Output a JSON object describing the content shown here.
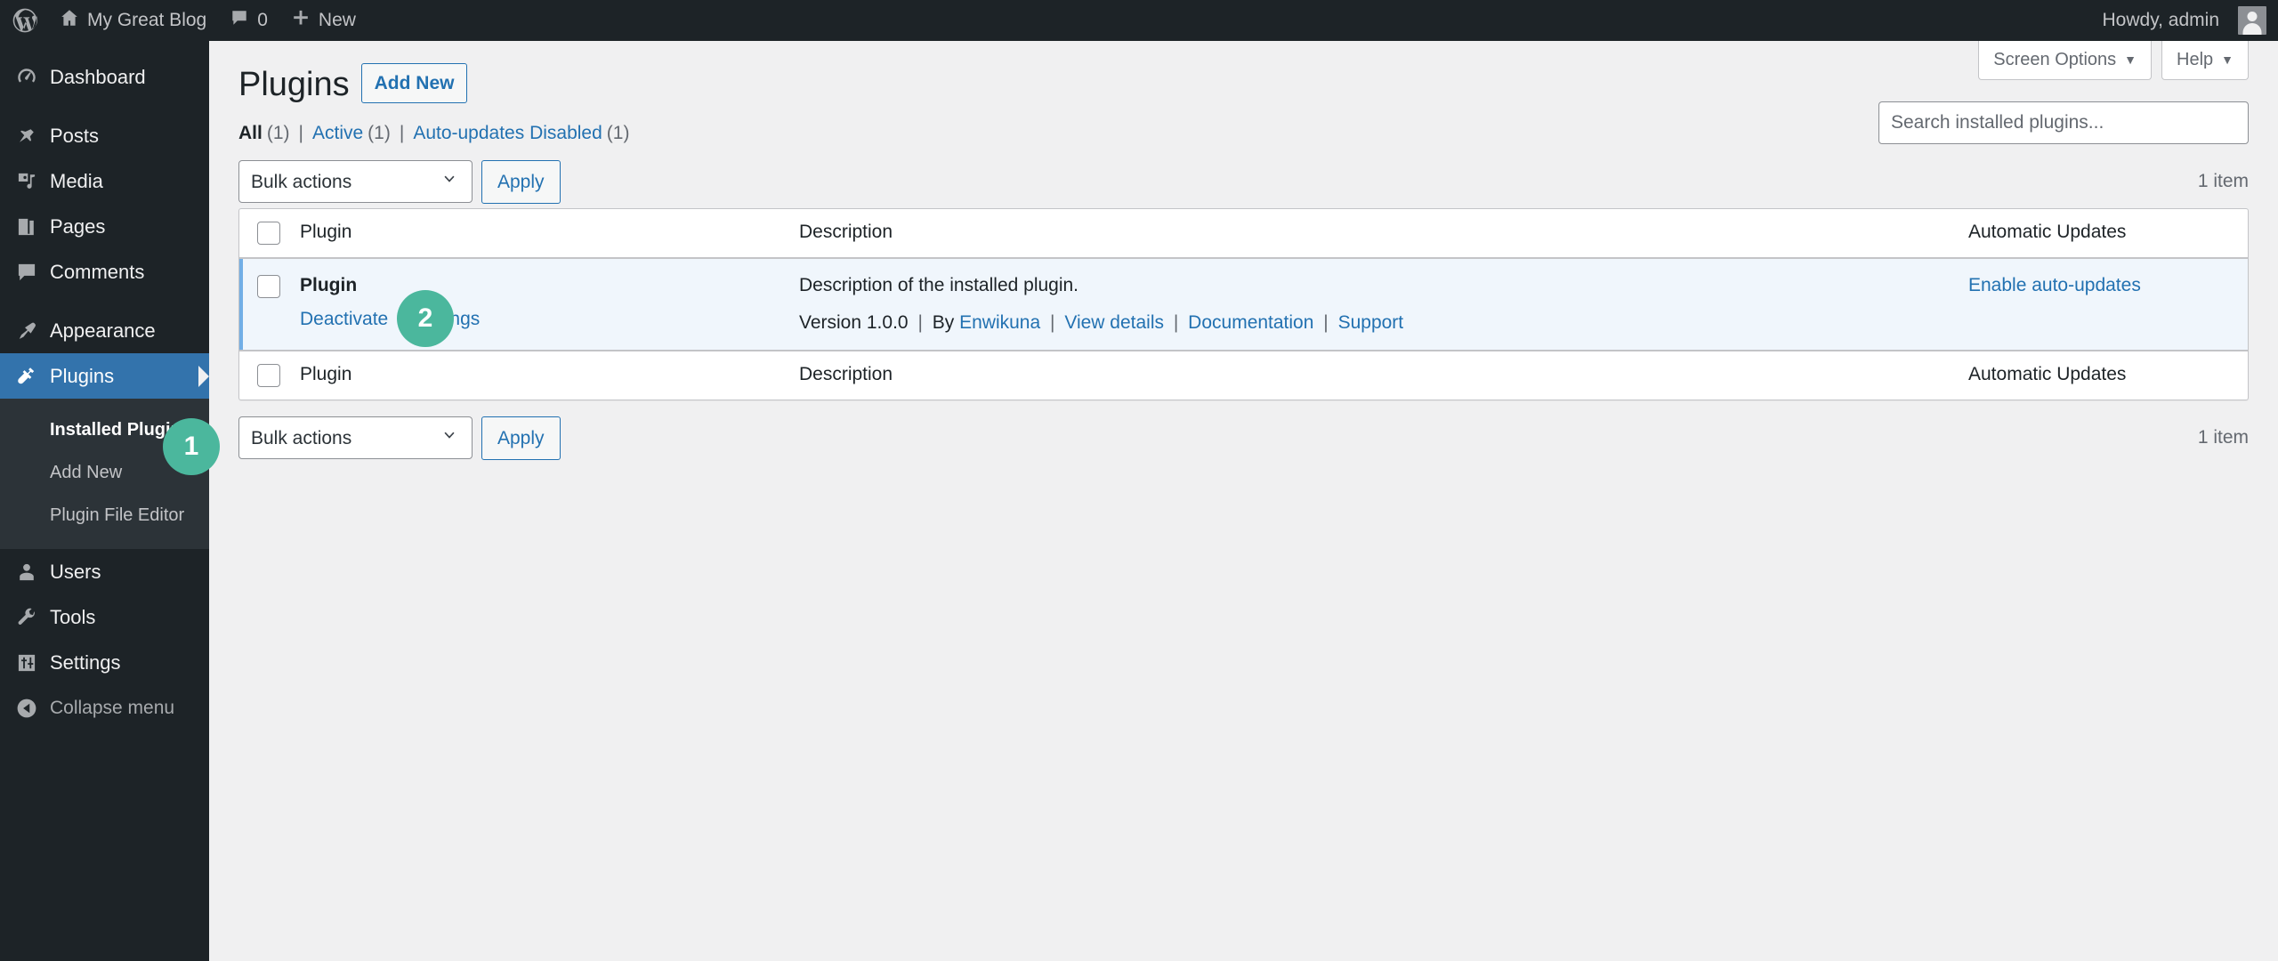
{
  "adminbar": {
    "logo_icon": "wordpress-logo-icon",
    "site_name": "My Great Blog",
    "site_icon": "home-icon",
    "comments_icon": "comment-bubble-icon",
    "comments_count": "0",
    "new_icon": "plus-icon",
    "new_label": "New",
    "howdy": "Howdy, admin",
    "avatar_icon": "avatar-icon"
  },
  "sidebar": {
    "items": [
      {
        "label": "Dashboard",
        "icon": "dashboard-icon",
        "current": false
      },
      {
        "label": "Posts",
        "icon": "pin-icon",
        "current": false
      },
      {
        "label": "Media",
        "icon": "media-icon",
        "current": false
      },
      {
        "label": "Pages",
        "icon": "pages-icon",
        "current": false
      },
      {
        "label": "Comments",
        "icon": "comment-bubble-icon",
        "current": false
      },
      {
        "label": "Appearance",
        "icon": "paintbrush-icon",
        "current": false
      },
      {
        "label": "Plugins",
        "icon": "plug-icon",
        "current": true
      },
      {
        "label": "Users",
        "icon": "user-icon",
        "current": false
      },
      {
        "label": "Tools",
        "icon": "wrench-icon",
        "current": false
      },
      {
        "label": "Settings",
        "icon": "settings-sliders-icon",
        "current": false
      }
    ],
    "submenu": [
      {
        "label": "Installed Plugins",
        "current": true
      },
      {
        "label": "Add New",
        "current": false
      },
      {
        "label": "Plugin File Editor",
        "current": false
      }
    ],
    "collapse": {
      "label": "Collapse menu",
      "icon": "collapse-arrow-icon"
    }
  },
  "screen_meta": {
    "screen_options": "Screen Options",
    "help": "Help",
    "caret": "▼"
  },
  "page": {
    "title": "Plugins",
    "add_new": "Add New"
  },
  "filters": {
    "all_label": "All",
    "all_count": "(1)",
    "active_label": "Active",
    "active_count": "(1)",
    "autoupdates_label": "Auto-updates Disabled",
    "autoupdates_count": "(1)",
    "separator": "|"
  },
  "search": {
    "placeholder": "Search installed plugins...",
    "value": ""
  },
  "tablenav_top": {
    "bulk_actions_selected": "Bulk actions",
    "apply_label": "Apply",
    "displaying_num": "1 item",
    "chevron_icon": "chevron-down-icon"
  },
  "tablenav_bottom": {
    "bulk_actions_selected": "Bulk actions",
    "apply_label": "Apply",
    "displaying_num": "1 item",
    "chevron_icon": "chevron-down-icon"
  },
  "table": {
    "columns": {
      "checkbox": "select-all-checkbox",
      "plugin": "Plugin",
      "description": "Description",
      "automatic_updates": "Automatic Updates"
    },
    "footer": {
      "plugin": "Plugin",
      "description": "Description",
      "automatic_updates": "Automatic Updates"
    },
    "rows": [
      {
        "name": "Plugin",
        "actions": [
          {
            "label": "Deactivate"
          },
          {
            "label": "Settings"
          }
        ],
        "action_separator": "|",
        "description": "Description of the installed plugin.",
        "version": "Version 1.0.0",
        "by_label": "By",
        "author": "Enwikuna",
        "meta_links": [
          {
            "label": "View details"
          },
          {
            "label": "Documentation"
          },
          {
            "label": "Support"
          }
        ],
        "meta_separator": "|",
        "auto_updates": "Enable auto-updates"
      }
    ]
  },
  "markers": [
    {
      "number": "1"
    },
    {
      "number": "2"
    }
  ],
  "colors": {
    "admin_dark": "#1d2327",
    "sidebar_submenu": "#2c3338",
    "current_menu": "#3373ac",
    "link_blue": "#2271b1",
    "page_bg": "#f0f0f1",
    "active_row": "#f0f6fc",
    "marker_green": "#4bb79d"
  }
}
